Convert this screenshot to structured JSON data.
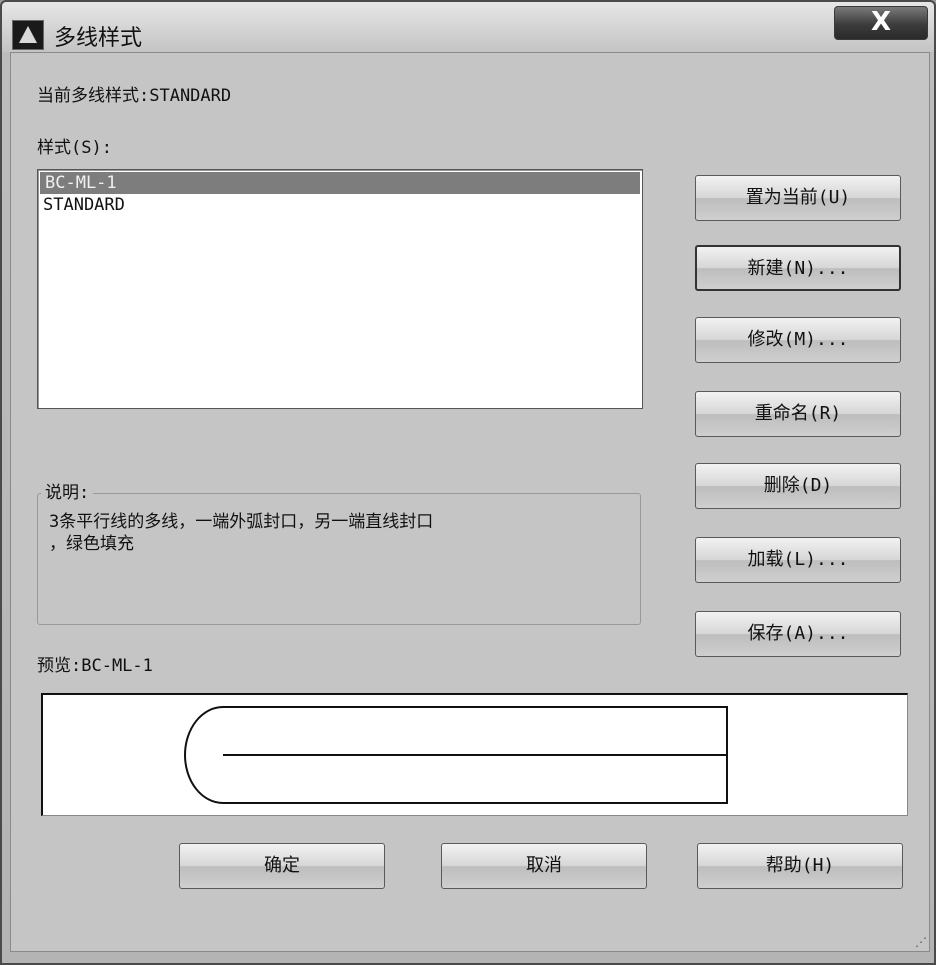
{
  "window": {
    "title": "多线样式",
    "close_label": "X"
  },
  "current_style": "当前多线样式:STANDARD",
  "styles_label": "样式(S):",
  "styles": [
    {
      "name": "BC-ML-1",
      "selected": true
    },
    {
      "name": "STANDARD",
      "selected": false
    }
  ],
  "buttons": {
    "set_current": "置为当前(U)",
    "new": "新建(N)...",
    "modify": "修改(M)...",
    "rename": "重命名(R)",
    "delete": "删除(D)",
    "load": "加载(L)...",
    "save": "保存(A)..."
  },
  "description": {
    "label": "说明:",
    "line1": "3条平行线的多线，一端外弧封口，另一端直线封口",
    "line2": "，绿色填充"
  },
  "preview_label": "预览:BC-ML-1",
  "footer": {
    "ok": "确定",
    "cancel": "取消",
    "help": "帮助(H)"
  }
}
